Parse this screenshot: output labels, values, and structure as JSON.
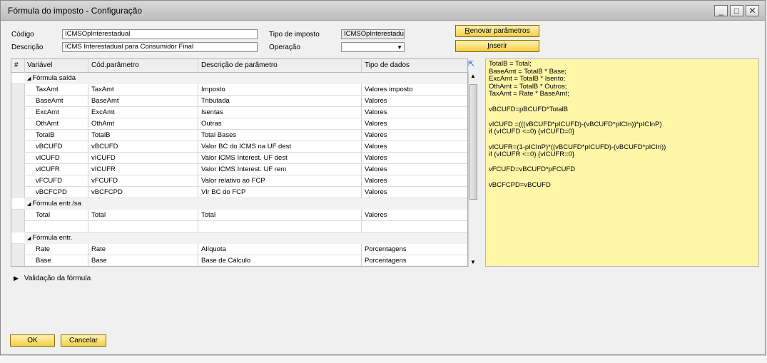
{
  "window": {
    "title": "Fórmula do imposto - Configuração"
  },
  "header": {
    "codigo_label": "Código",
    "codigo_value": "ICMSOpInterestadual",
    "descricao_label": "Descrição",
    "descricao_value": "ICMS Interestadual para Consumidor Final",
    "tipo_label": "Tipo de imposto",
    "tipo_value": "ICMSOpInterestadu",
    "operacao_label": "Operação",
    "operacao_value": ""
  },
  "buttons": {
    "renovar_pre": "",
    "renovar_hot": "R",
    "renovar_post": "enovar parâmetros",
    "inserir_pre": "",
    "inserir_hot": "I",
    "inserir_post": "nserir",
    "ok": "OK",
    "cancel": "Cancelar"
  },
  "grid": {
    "columns": [
      "#",
      "Variável",
      "Cód.parâmetro",
      "Descrição de parâmetro",
      "Tipo de dados"
    ],
    "groups": [
      {
        "name": "Fórmula saída",
        "rows": [
          [
            "TaxAmt",
            "TaxAmt",
            "Imposto",
            "Valores imposto"
          ],
          [
            "BaseAmt",
            "BaseAmt",
            "Tributada",
            "Valores"
          ],
          [
            "ExcAmt",
            "ExcAmt",
            "Isentas",
            "Valores"
          ],
          [
            "OthAmt",
            "OthAmt",
            "Outras",
            "Valores"
          ],
          [
            "TotalB",
            "TotalB",
            "Total Bases",
            "Valores"
          ],
          [
            "vBCUFD",
            "vBCUFD",
            "Valor BC do ICMS na UF dest",
            "Valores"
          ],
          [
            "vICUFD",
            "vICUFD",
            "Valor ICMS Interest. UF dest",
            "Valores"
          ],
          [
            "vICUFR",
            "vICUFR",
            "Valor ICMS Interest. UF rem",
            "Valores"
          ],
          [
            "vFCUFD",
            "vFCUFD",
            "Valor relativo ao FCP",
            "Valores"
          ],
          [
            "vBCFCPD",
            "vBCFCPD",
            "Vlr BC do FCP",
            "Valores"
          ]
        ]
      },
      {
        "name": "Fórmula entr./sa",
        "rows": [
          [
            "Total",
            "Total",
            "Total",
            "Valores"
          ],
          [
            "",
            "",
            "",
            ""
          ]
        ]
      },
      {
        "name": "Fórmula entr.",
        "rows": [
          [
            "Rate",
            "Rate",
            "Alíquota",
            "Porcentagens"
          ],
          [
            "Base",
            "Base",
            "Base de Cálculo",
            "Porcentagens"
          ]
        ]
      }
    ]
  },
  "formula_text": "TotalB = Total;\nBaseAmt = TotalB * Base;\nExcAmt = TotalB * Isento;\nOthAmt = TotalB * Outros;\nTaxAmt = Rate * BaseAmt;\n\nvBCUFD=pBCUFD*TotalB\n\nvICUFD =(((vBCUFD*pICUFD)-(vBCUFD*pICIn))*pICInP)\nif (vICUFD <=0) {vICUFD=0}\n\nvICUFR=(1-pICInP)*((vBCUFD*pICUFD)-(vBCUFD*pICIn))\nif (vICUFR <=0) {vICUFR=0}\n\nvFCUFD=vBCUFD*pFCUFD\n\nvBCFCPD=vBCUFD",
  "validation": {
    "label": "Validação da fórmula"
  },
  "icons": [
    "minimize-icon",
    "maximize-icon",
    "close-icon",
    "expand-arrow-icon",
    "group-collapse-icon",
    "chevron-down-icon",
    "triangle-right-icon"
  ]
}
